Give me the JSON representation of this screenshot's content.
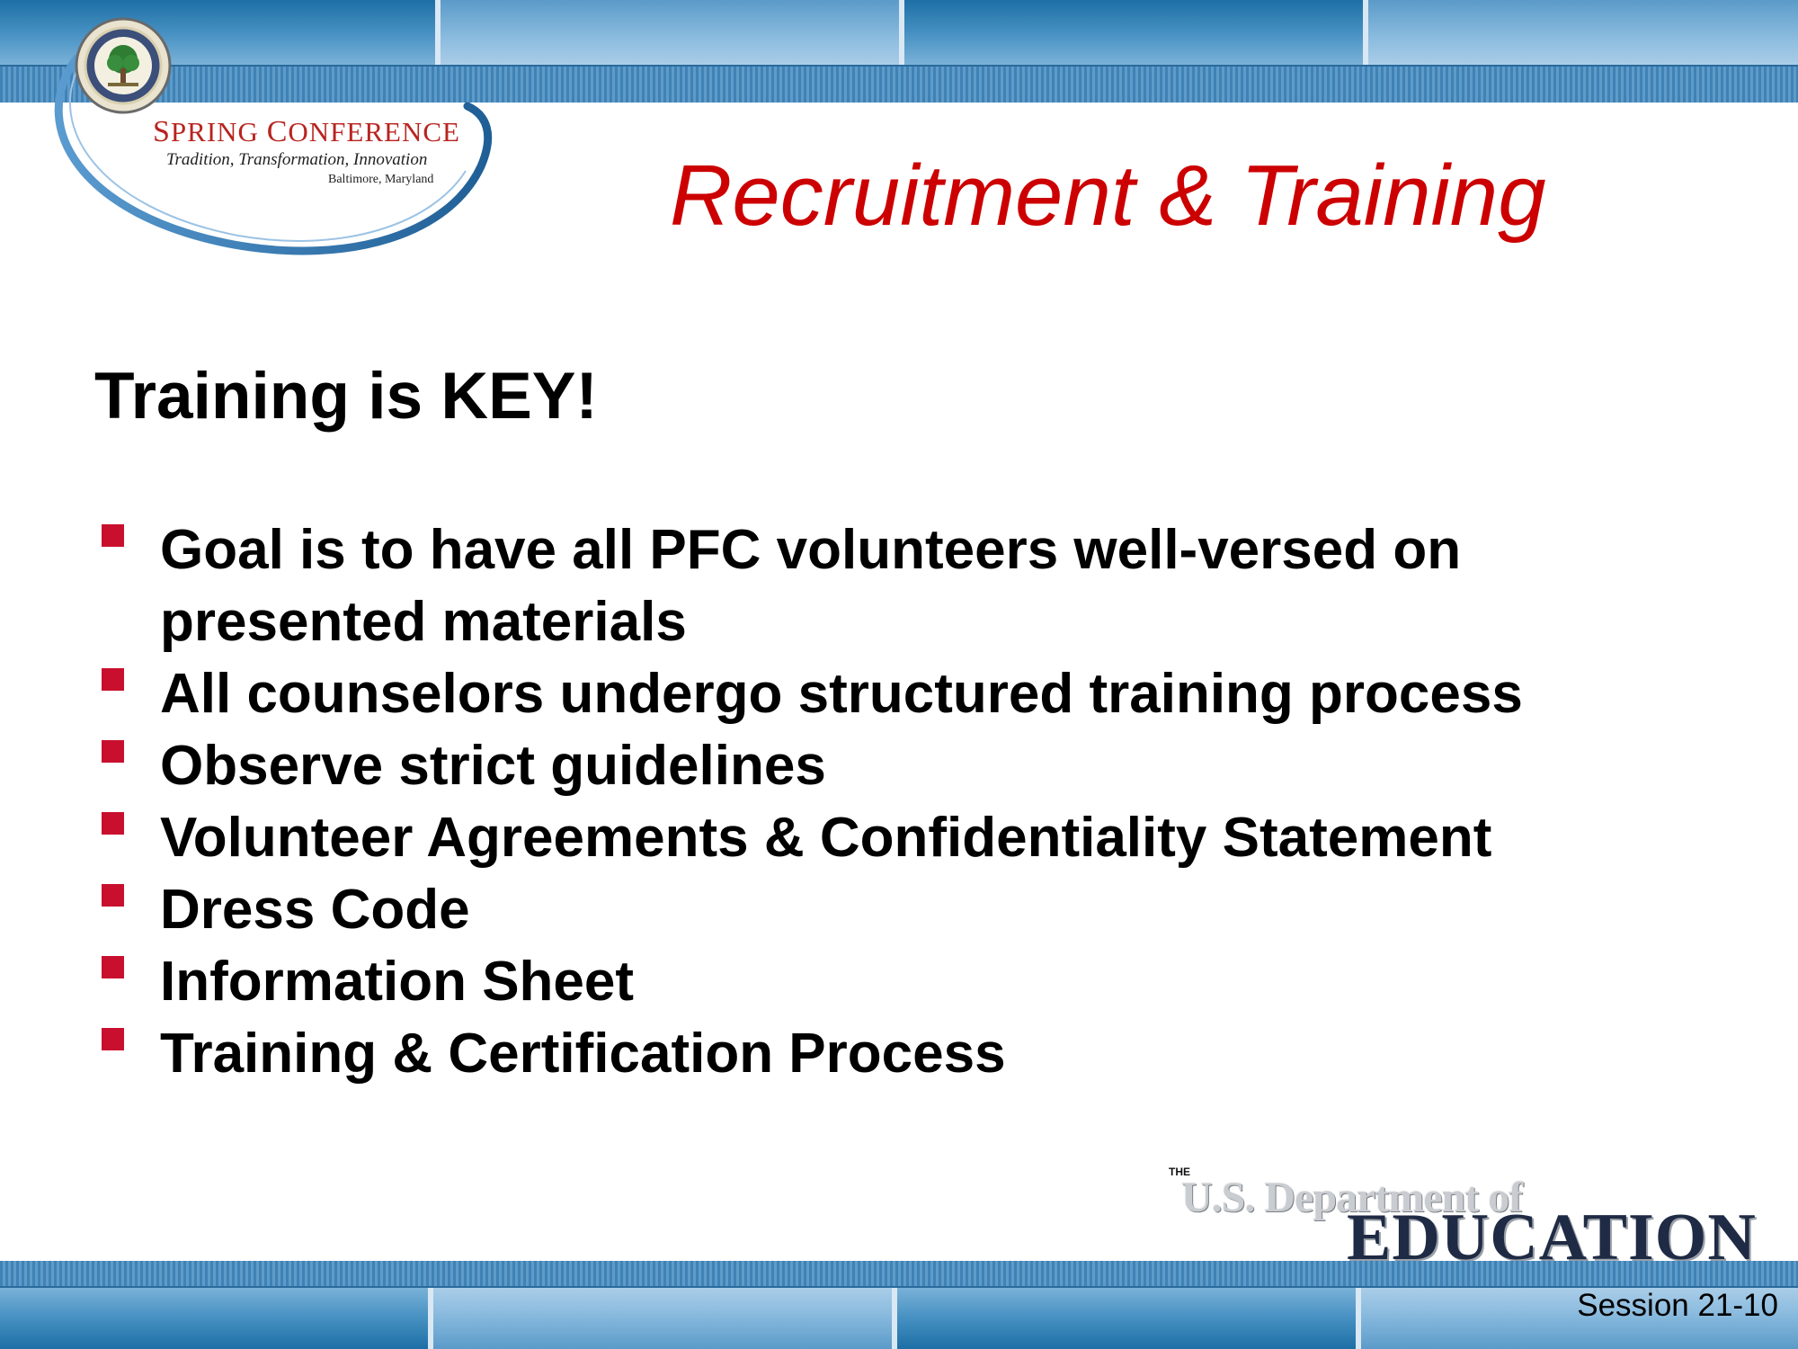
{
  "header": {
    "title": "Recruitment & Training"
  },
  "conference_logo": {
    "name": "Spring Conference",
    "tagline": "Tradition, Transformation, Innovation",
    "location": "Baltimore, Maryland"
  },
  "content": {
    "subheading": "Training is KEY!",
    "bullets": [
      "Goal is to have all PFC volunteers well-versed on presented materials",
      "All counselors undergo structured training process",
      "Observe strict guidelines",
      "Volunteer Agreements & Confidentiality Statement",
      "Dress Code",
      "Information Sheet",
      "Training & Certification Process"
    ]
  },
  "ed_logo": {
    "line1": "THE",
    "line2": "U.S. Department of",
    "line3": "EDUCATION"
  },
  "footer": {
    "session": "Session 21-10"
  },
  "colors": {
    "title": "#cc0000",
    "bullet_marker": "#c8102e",
    "band_dark": "#1d6fa6",
    "band_light": "#8cbcdf",
    "conference_arc": "#2f6fa3",
    "conference_name": "#b8241f"
  }
}
